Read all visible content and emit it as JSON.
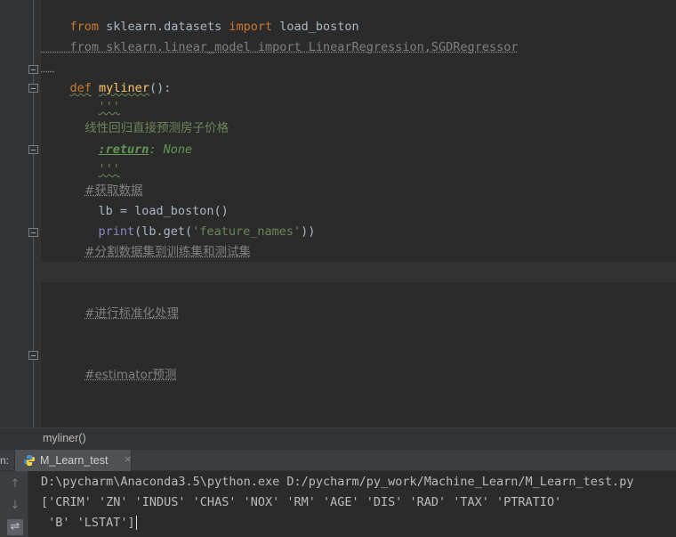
{
  "editor": {
    "lines": {
      "l1": {
        "kw1": "from",
        "mid": " sklearn.datasets ",
        "kw2": "import",
        "rest": " load_boston"
      },
      "l2": {
        "kw1": "from",
        "mid": " sklearn.linear_model ",
        "kw2": "import",
        "rest": " LinearRegression,SGDRegressor"
      },
      "l3": {
        "kw": "def",
        "fn": "myliner",
        "rest": "():"
      },
      "l4": {
        "quote": "'''"
      },
      "l5": {
        "text": "线性回归直接预测房子价格"
      },
      "l6": {
        "tag": ":return",
        "rest": ": None"
      },
      "l7": {
        "quote": "'''"
      },
      "l8": {
        "comment": "#获取数据"
      },
      "l9": {
        "code": "lb = load_boston()"
      },
      "l10": {
        "builtin": "print",
        "open": "(lb.get(",
        "str": "'feature_names'",
        "close": "))"
      },
      "l11": {
        "comment": "#分割数据集到训练集和测试集"
      },
      "l12": {
        "comment": "#进行标准化处理"
      },
      "l13": {
        "comment": "#estimator预测"
      }
    }
  },
  "breadcrumb": {
    "label": "myliner()"
  },
  "run_panel": {
    "prefix": "n:",
    "tab_label": "M_Learn_test",
    "tab_close": "×",
    "tools": {
      "up": "↑",
      "down": "↓",
      "wrap": "⇌"
    }
  },
  "console": {
    "line1": "D:\\pycharm\\Anaconda3.5\\python.exe D:/pycharm/py_work/Machine_Learn/M_Learn_test.py",
    "line2": "['CRIM' 'ZN' 'INDUS' 'CHAS' 'NOX' 'RM' 'AGE' 'DIS' 'RAD' 'TAX' 'PTRATIO'",
    "line3": " 'B' 'LSTAT']"
  },
  "colors": {
    "background": "#2b2b2b",
    "keyword": "#cc7832",
    "function": "#ffc66d",
    "string": "#6a8759",
    "comment": "#808080",
    "text": "#a9b7c6"
  }
}
